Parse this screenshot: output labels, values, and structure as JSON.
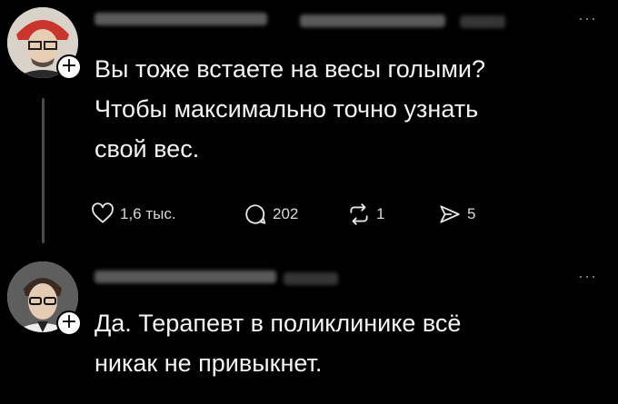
{
  "posts": [
    {
      "text": "Вы тоже встаете на весы голыми?\nЧтобы максимально точно узнать\nсвой вес.",
      "actions": {
        "likes": "1,6 тыс.",
        "replies": "202",
        "reposts": "1",
        "shares": "5"
      }
    },
    {
      "text": "Да. Терапевт в поликлинике всё\nникак не привыкнет."
    }
  ],
  "icons": {
    "follow": "plus-icon",
    "more": "more-icon",
    "like": "heart-icon",
    "reply": "comment-icon",
    "repost": "repost-icon",
    "share": "share-icon"
  },
  "colors": {
    "background": "#000000",
    "text": "#f4f4f4",
    "muted": "#8a8a8a"
  }
}
